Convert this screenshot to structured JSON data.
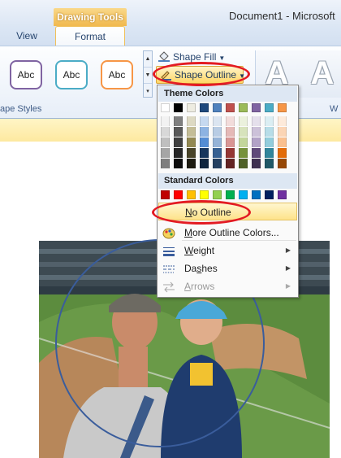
{
  "window": {
    "contextual_tab": "Drawing Tools",
    "document_title": "Document1 - Microsoft"
  },
  "tabs": [
    {
      "label": "View",
      "selected": false
    },
    {
      "label": "Format",
      "selected": true
    }
  ],
  "ribbon": {
    "shape_style_samples": [
      "Abc",
      "Abc",
      "Abc"
    ],
    "shape_style_colors": [
      "#8064a2",
      "#4bacc6",
      "#f79646"
    ],
    "group_shape_styles": "ape Styles",
    "shape_fill_label": "Shape Fill",
    "shape_outline_label": "Shape Outline",
    "wordart_samples": [
      "A",
      "A"
    ],
    "wordart_group_label": "W"
  },
  "menu": {
    "theme_colors_header": "Theme Colors",
    "standard_colors_header": "Standard Colors",
    "theme_colors": [
      "#ffffff",
      "#000000",
      "#eeece1",
      "#1f497d",
      "#4f81bd",
      "#c0504d",
      "#9bbb59",
      "#8064a2",
      "#4bacc6",
      "#f79646"
    ],
    "theme_tints": [
      [
        "#f2f2f2",
        "#d8d8d8",
        "#bfbfbf",
        "#a5a5a5",
        "#7f7f7f"
      ],
      [
        "#7f7f7f",
        "#595959",
        "#3f3f3f",
        "#262626",
        "#0c0c0c"
      ],
      [
        "#ddd9c3",
        "#c4bd97",
        "#938953",
        "#494429",
        "#1d1b10"
      ],
      [
        "#c6d9f0",
        "#8db3e2",
        "#548dd4",
        "#17365d",
        "#0f243e"
      ],
      [
        "#dbe5f1",
        "#b8cce4",
        "#95b3d7",
        "#366092",
        "#244061"
      ],
      [
        "#f2dcdb",
        "#e5b9b7",
        "#d99694",
        "#953734",
        "#632423"
      ],
      [
        "#ebf1dd",
        "#d7e3bc",
        "#c3d69b",
        "#76923c",
        "#4f6128"
      ],
      [
        "#e5e0ec",
        "#ccc1d9",
        "#b2a2c7",
        "#5f497a",
        "#3f3151"
      ],
      [
        "#dbeef3",
        "#b7dde8",
        "#92cddc",
        "#31859b",
        "#205867"
      ],
      [
        "#fdeada",
        "#fbd5b5",
        "#fac08f",
        "#e36c09",
        "#974806"
      ]
    ],
    "standard_colors": [
      "#c00000",
      "#ff0000",
      "#ffc000",
      "#ffff00",
      "#92d050",
      "#00b050",
      "#00b0f0",
      "#0070c0",
      "#002060",
      "#7030a0"
    ],
    "items": {
      "no_outline": {
        "mnemonic": "N",
        "rest": "o Outline"
      },
      "more_colors": {
        "mnemonic": "M",
        "rest": "ore Outline Colors..."
      },
      "weight": {
        "mnemonic": "W",
        "rest": "eight"
      },
      "dashes": {
        "pre": "Da",
        "mnemonic": "s",
        "rest": "hes"
      },
      "arrows": {
        "mnemonic": "A",
        "rest": "rrows"
      }
    },
    "highlight_color": "#e31b23"
  }
}
